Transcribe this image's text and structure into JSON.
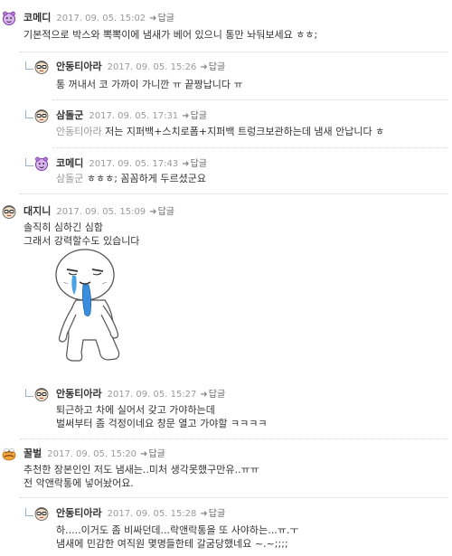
{
  "reply_label": "답글",
  "comments": [
    {
      "nick": "코메디",
      "date": "2017. 09. 05. 15:02",
      "avatar": "purple-face-icon",
      "lines": [
        "기본적으로 박스와 뽁뽁이에 냄새가 베어 있으니 통만 놔둬보세요 ㅎㅎ;"
      ]
    },
    {
      "nick": "안동티아라",
      "date": "2017. 09. 05. 15:26",
      "avatar": "glasses-face-icon",
      "lines": [
        "통 꺼내서 코 가까이 가니깐 ㅠ 끝짱납니다 ㅠ"
      ]
    },
    {
      "nick": "삼돌군",
      "date": "2017. 09. 05. 17:31",
      "avatar": "glasses-face-icon",
      "mention": "안동티아라",
      "lines": [
        "저는 지퍼백+스치로폼+지퍼백 트렁크보관하는데 냄새 안납니다 ㅎ"
      ]
    },
    {
      "nick": "코메디",
      "date": "2017. 09. 05. 17:43",
      "avatar": "purple-face-icon",
      "mention": "삼돌군",
      "lines": [
        "ㅎㅎㅎ; 꼼꼼하게 두르셨군요"
      ]
    },
    {
      "nick": "대지니",
      "date": "2017. 09. 05. 15:09",
      "avatar": "glasses-face-icon",
      "lines": [
        "솔직히 심하긴 심함",
        "그래서 강력할수도 있습니다"
      ]
    },
    {
      "nick": "안동티아라",
      "date": "2017. 09. 05. 15:27",
      "avatar": "glasses-face-icon",
      "lines": [
        "퇴근하고 차에 실어서 갖고 가야하는데",
        "벌써부터 좀 걱정이네요 창문 열고 가야할 ㅋㅋㅋㅋ"
      ]
    },
    {
      "nick": "꿀벌",
      "date": "2017. 09. 05. 15:20",
      "avatar": "bee-icon",
      "lines": [
        "추천한 장본인인 저도 냄새는..미처 생각못했구만유..ㅠㅠ",
        "전 악앤락통에 넣어놨어요."
      ]
    },
    {
      "nick": "안동티아라",
      "date": "2017. 09. 05. 15:28",
      "avatar": "glasses-face-icon",
      "lines": [
        "하.....이거도 좀 비싸던데...락앤락통을 또 사야하는...ㅠ.ㅜ",
        "냄새에 민감한 여직원 몇명들한테 갈굼당했네요 ~.~;;;;"
      ]
    }
  ]
}
